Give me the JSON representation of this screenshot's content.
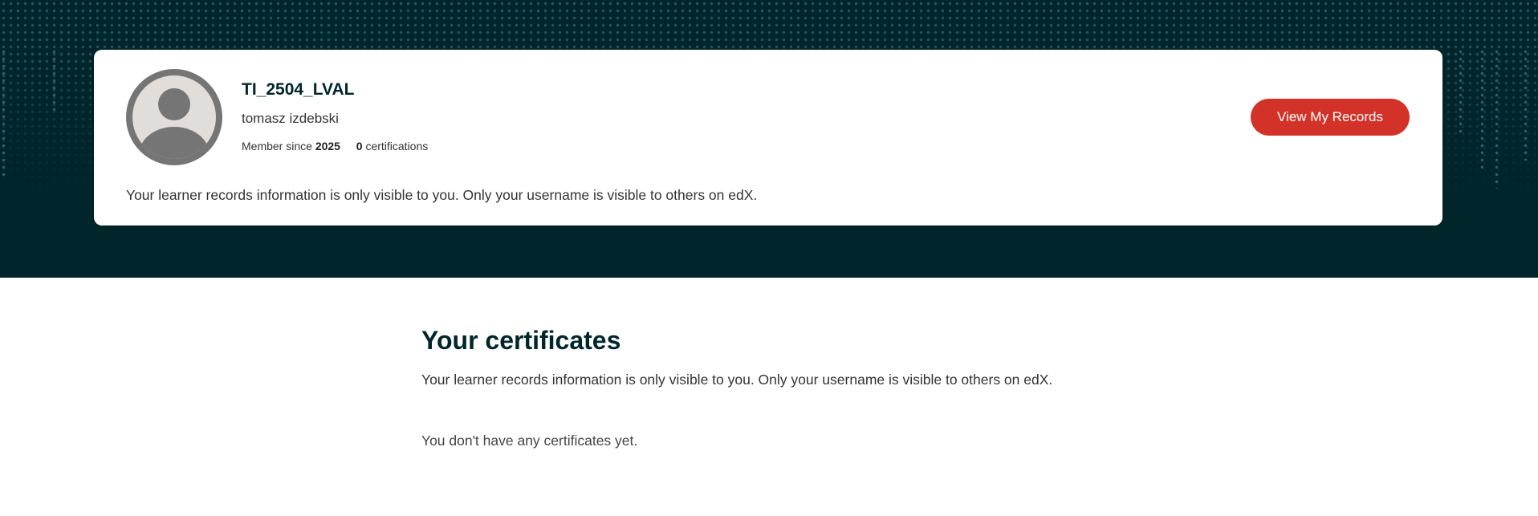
{
  "profile": {
    "username": "TI_2504_LVAL",
    "full_name": "tomasz izdebski",
    "member_since_label": "Member since",
    "member_since_year": "2025",
    "certifications_count": "0",
    "certifications_label": "certifications",
    "privacy_note": "Your learner records information is only visible to you. Only your username is visible to others on edX.",
    "view_records_label": "View My Records",
    "avatar_icon": "default-user-avatar-icon"
  },
  "certificates": {
    "title": "Your certificates",
    "description": "Your learner records information is only visible to you. Only your username is visible to others on edX.",
    "empty_message": "You don't have any certificates yet."
  },
  "colors": {
    "hero_background": "#00262b",
    "primary_button": "#d23228",
    "heading": "#00262b"
  }
}
